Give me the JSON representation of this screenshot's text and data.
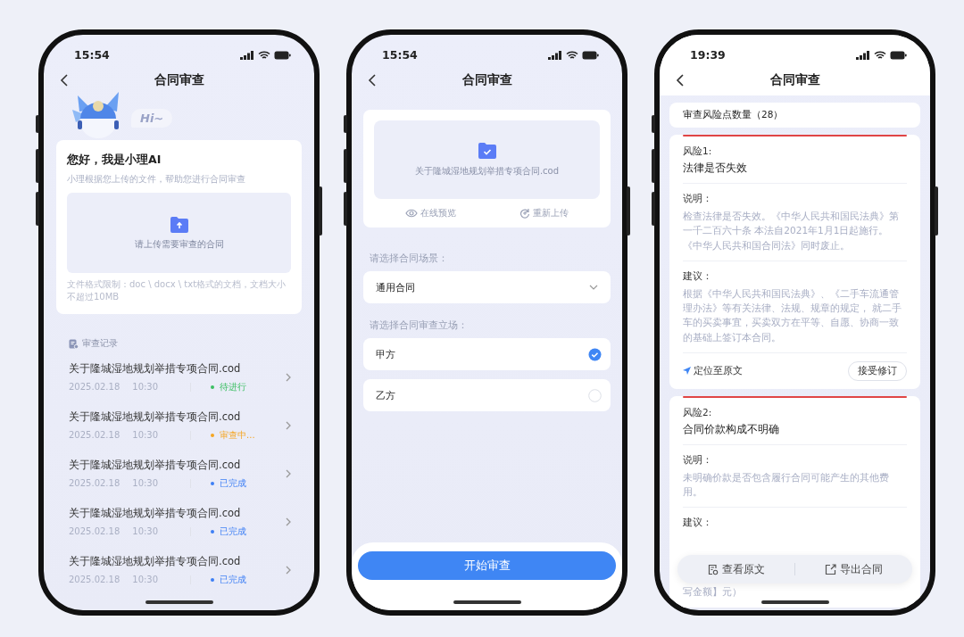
{
  "phones": [
    {
      "kind": "home",
      "status_bar": {
        "time": "15:54"
      },
      "title": "合同审查",
      "mascot_bubble": "Hi~",
      "intro": {
        "heading": "您好，我是小理AI",
        "subtitle": "小理根据您上传的文件，帮助您进行合同审查",
        "upload_prompt": "请上传需要审查的合同",
        "format_note": "文件格式限制：doc \\ docx \\ txt格式的文档，文档大小不超过10MB"
      },
      "records": {
        "heading": "审查记录",
        "items": [
          {
            "name": "关于隆城湿地规划举措专项合同.cod",
            "date": "2025.02.18",
            "time": "10:30",
            "status": "待进行",
            "color": "#3cbf63"
          },
          {
            "name": "关于隆城湿地规划举措专项合同.cod",
            "date": "2025.02.18",
            "time": "10:30",
            "status": "审查中...",
            "color": "#f5a623"
          },
          {
            "name": "关于隆城湿地规划举措专项合同.cod",
            "date": "2025.02.18",
            "time": "10:30",
            "status": "已完成",
            "color": "#3d7ff5"
          },
          {
            "name": "关于隆城湿地规划举措专项合同.cod",
            "date": "2025.02.18",
            "time": "10:30",
            "status": "已完成",
            "color": "#3d7ff5"
          },
          {
            "name": "关于隆城湿地规划举措专项合同.cod",
            "date": "2025.02.18",
            "time": "10:30",
            "status": "已完成",
            "color": "#3d7ff5"
          }
        ]
      }
    },
    {
      "kind": "setup",
      "status_bar": {
        "time": "15:54"
      },
      "title": "合同审查",
      "file": {
        "name": "关于隆城湿地规划举措专项合同.cod",
        "actions": [
          {
            "kind": "preview",
            "label": "在线预览"
          },
          {
            "kind": "reupload",
            "label": "重新上传"
          }
        ]
      },
      "scene": {
        "label": "请选择合同场景：",
        "value": "通用合同"
      },
      "stance": {
        "label": "请选择合同审查立场：",
        "options": [
          {
            "label": "甲方",
            "selected": true
          },
          {
            "label": "乙方",
            "selected": false
          }
        ]
      },
      "start_button": "开始审查"
    },
    {
      "kind": "results",
      "status_bar": {
        "time": "19:39"
      },
      "title": "合同审查",
      "risk_count": "审查风险点数量（28）",
      "risks": [
        {
          "label": "风险1:",
          "title": "法律是否失效",
          "explanation_label": "说明：",
          "explanation": "检查法律是否失效。《中华人民共和国民法典》第一千二百六十条 本法自2021年1月1日起施行。《中华人民共和国合同法》同时废止。",
          "suggestion_label": "建议：",
          "suggestion": "根据《中华人民共和国民法典》、《二手车流通管理办法》等有关法律、法规、规章的规定， 就二手车的买卖事宜，买卖双方在平等、自愿、协商一致的基础上签订本合同。",
          "locate": "定位至原文",
          "accept": "接受修订"
        },
        {
          "label": "风险2:",
          "title": "合同价款构成不明确",
          "explanation_label": "说明：",
          "explanation": "未明确价款是否包含履行合同可能产生的其他费用。",
          "suggestion_label": "建议：",
          "suggestion": "写金额】元）"
        }
      ],
      "bottom_bar": [
        {
          "kind": "view",
          "label": "查看原文"
        },
        {
          "kind": "export",
          "label": "导出合同"
        }
      ]
    }
  ]
}
